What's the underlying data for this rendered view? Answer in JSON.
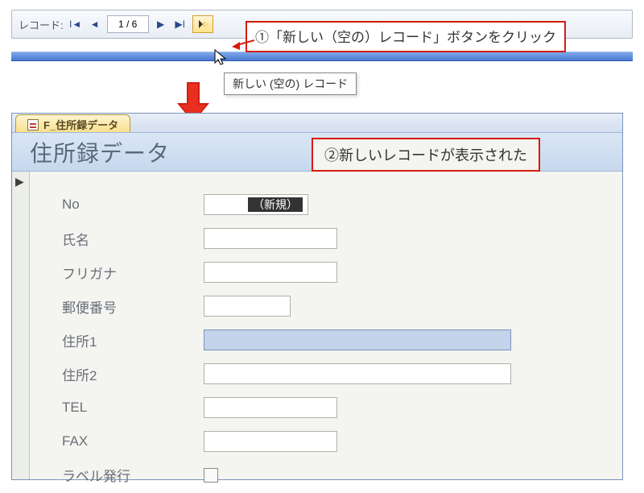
{
  "nav": {
    "label": "レコード:",
    "counter": "1 / 6",
    "tooltip": "新しい (空の) レコード"
  },
  "callouts": {
    "c1": "①「新しい（空の）レコード」ボタンをクリック",
    "c2": "②新しいレコードが表示された"
  },
  "form": {
    "tab_name": "F_住所録データ",
    "title": "住所録データ",
    "no_label": "No",
    "no_value": "（新規）",
    "fields": {
      "name": "氏名",
      "furigana": "フリガナ",
      "zip": "郵便番号",
      "addr1": "住所1",
      "addr2": "住所2",
      "tel": "TEL",
      "fax": "FAX",
      "label_issue": "ラベル発行"
    }
  }
}
